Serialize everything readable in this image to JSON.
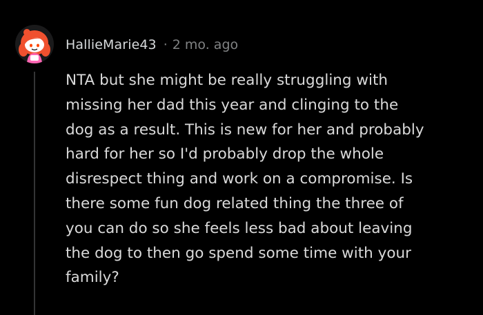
{
  "comment": {
    "username": "HallieMarie43",
    "separator": "·",
    "timestamp": "2 mo. ago",
    "avatar_icon": "snoo-avatar-icon",
    "body_lines": [
      "NTA but she might be really struggling with",
      "missing her dad this year and clinging to the",
      "dog as a result. This is new for her and probably",
      "hard for her so I'd probably drop the whole",
      "disrespect thing and work on a compromise. Is",
      "there some fun dog related thing the three of",
      "you can do so she feels less bad about leaving",
      "the dog to then go spend some time with your",
      "family?"
    ]
  },
  "colors": {
    "background": "#000000",
    "text": "#dadada",
    "meta": "#818384",
    "hair": "#f0512f",
    "shirt": "#ff66b3"
  }
}
